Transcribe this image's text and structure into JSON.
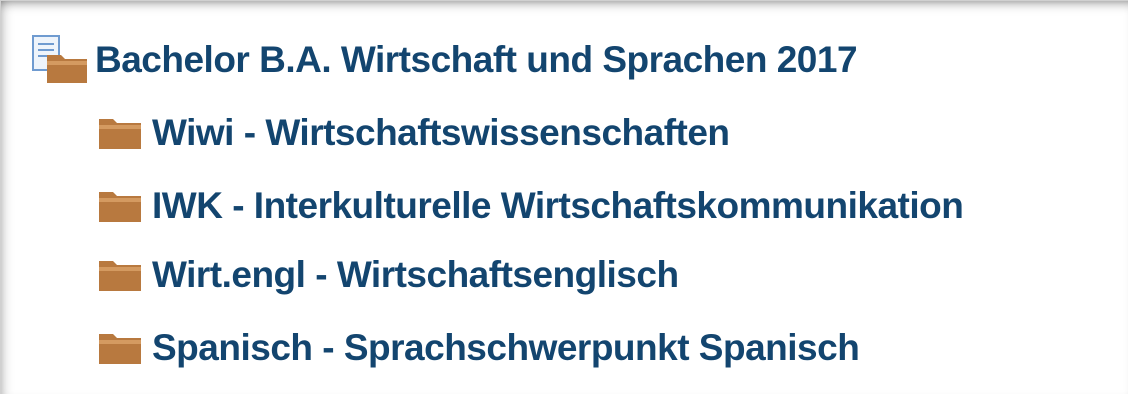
{
  "tree": {
    "root": {
      "label": "Bachelor B.A. Wirtschaft und Sprachen 2017",
      "icon": "document-folder-icon"
    },
    "children": [
      {
        "label": "Wiwi - Wirtschaftswissenschaften",
        "icon": "folder-icon"
      },
      {
        "label": "IWK - Interkulturelle Wirtschaftskommunikation",
        "icon": "folder-icon"
      },
      {
        "label": "Wirt.engl - Wirtschaftsenglisch",
        "icon": "folder-icon"
      },
      {
        "label": "Spanisch - Sprachschwerpunkt Spanisch",
        "icon": "folder-icon"
      }
    ]
  },
  "colors": {
    "text": "#13456f",
    "folder": "#b8793f",
    "folder_top": "#d49a60",
    "document": "#6f9bd0"
  }
}
